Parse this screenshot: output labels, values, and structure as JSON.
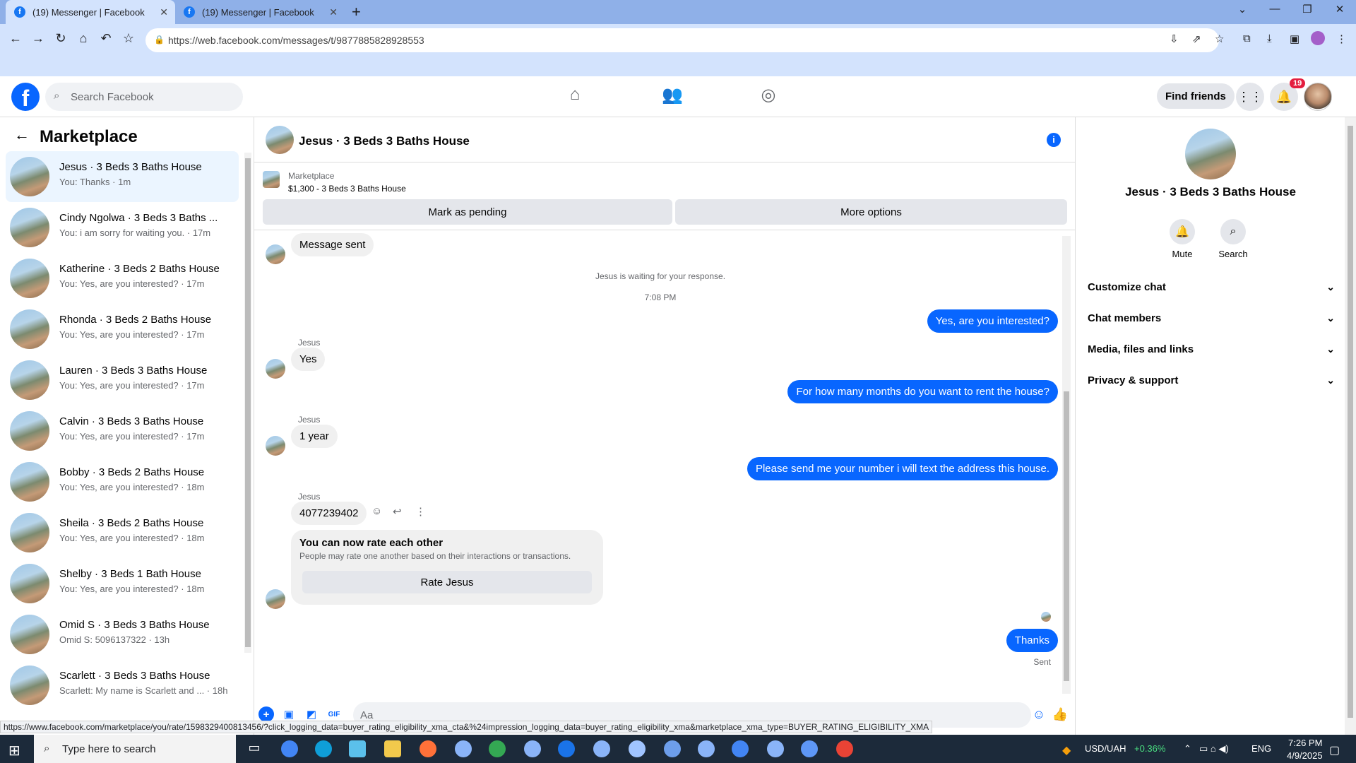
{
  "browser": {
    "tabs": [
      {
        "title": "(19) Messenger | Facebook"
      },
      {
        "title": "(19) Messenger | Facebook"
      }
    ],
    "url": "https://web.facebook.com/messages/t/9877885828928553"
  },
  "header": {
    "search_placeholder": "Search Facebook",
    "find_friends": "Find friends",
    "notifications_count": "19"
  },
  "sidebar": {
    "title": "Marketplace",
    "conversations": [
      {
        "name": "Jesus · 3 Beds 3 Baths House",
        "preview": "You: Thanks · 1m",
        "active": true
      },
      {
        "name": "Cindy Ngolwa · 3 Beds 3 Baths ...",
        "preview": "You: i am sorry for waiting you. · 17m"
      },
      {
        "name": "Katherine · 3 Beds 2 Baths House",
        "preview": "You: Yes, are you interested? · 17m"
      },
      {
        "name": "Rhonda · 3 Beds 2 Baths House",
        "preview": "You: Yes, are you interested? · 17m"
      },
      {
        "name": "Lauren · 3 Beds 3 Baths House",
        "preview": "You: Yes, are you interested? · 17m"
      },
      {
        "name": "Calvin · 3 Beds 3 Baths House",
        "preview": "You: Yes, are you interested? · 17m"
      },
      {
        "name": "Bobby · 3 Beds 2 Baths House",
        "preview": "You: Yes, are you interested? · 18m"
      },
      {
        "name": "Sheila · 3 Beds 2 Baths House",
        "preview": "You: Yes, are you interested? · 18m"
      },
      {
        "name": "Shelby · 3 Beds 1 Bath House",
        "preview": "You: Yes, are you interested? · 18m"
      },
      {
        "name": "Omid S · 3 Beds 3 Baths House",
        "preview": "Omid S: 5096137322 · 13h"
      },
      {
        "name": "Scarlett · 3 Beds 3 Baths House",
        "preview": "Scarlett: My name is Scarlett and ... · 18h"
      }
    ]
  },
  "chat": {
    "title": "Jesus · 3 Beds 3 Baths House",
    "marketplace_label": "Marketplace",
    "listing": "$1,300 - 3 Beds 3 Baths House",
    "mark_pending": "Mark as pending",
    "more_options": "More options",
    "messages": {
      "msg_sent": "Message sent",
      "waiting": "Jesus is waiting for your response.",
      "time": "7:08 PM",
      "out1": "Yes, are you interested?",
      "sender": "Jesus",
      "in1": "Yes",
      "out2": "For how many months do you want to rent the house?",
      "in2": "1 year",
      "out3": "Please send me your number i will text the address this house.",
      "in3": "4077239402",
      "rate_title": "You can now rate each other",
      "rate_sub": "People may rate one another based on their interactions or transactions.",
      "rate_btn": "Rate Jesus",
      "out4": "Thanks",
      "status": "Sent"
    },
    "composer_placeholder": "Aa"
  },
  "right_panel": {
    "name": "Jesus · 3 Beds 3 Baths House",
    "mute": "Mute",
    "search": "Search",
    "sections": [
      "Customize chat",
      "Chat members",
      "Media, files and links",
      "Privacy & support"
    ]
  },
  "status_url": "https://www.facebook.com/marketplace/you/rate/1598329400813456/?click_logging_data=buyer_rating_eligibility_xma_cta&%24impression_logging_data=buyer_rating_eligibility_xma&marketplace_xma_type=BUYER_RATING_ELIGIBILITY_XMA",
  "taskbar": {
    "search": "Type here to search",
    "currency": "USD/UAH",
    "change": "+0.36%",
    "lang": "ENG",
    "time": "7:26 PM",
    "date": "4/9/2025"
  },
  "colors": {
    "accent": "#0866ff",
    "badge": "#e41e3f",
    "change_green": "#4ade80"
  }
}
